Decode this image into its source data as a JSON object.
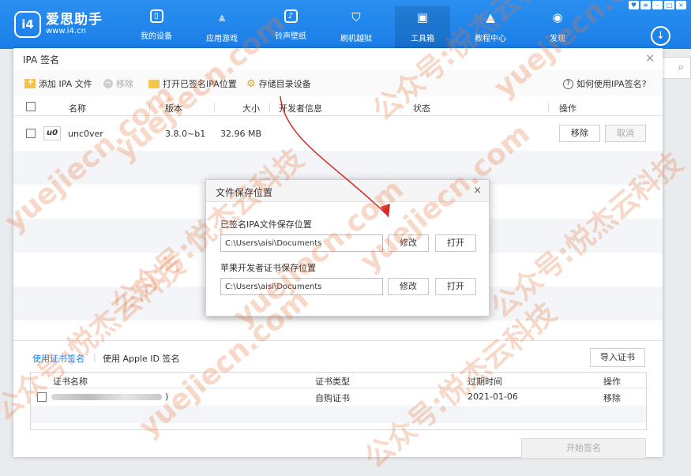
{
  "app": {
    "name": "爱思助手",
    "url": "www.i4.cn",
    "logo_mark": "i4"
  },
  "nav": [
    {
      "label": "我的设备",
      "icon": "device-icon"
    },
    {
      "label": "应用游戏",
      "icon": "apps-icon"
    },
    {
      "label": "铃声壁纸",
      "icon": "music-icon"
    },
    {
      "label": "刷机越狱",
      "icon": "flash-icon"
    },
    {
      "label": "工具箱",
      "icon": "toolbox-icon"
    },
    {
      "label": "教程中心",
      "icon": "graduation-cap-icon"
    },
    {
      "label": "发现",
      "icon": "compass-icon"
    }
  ],
  "dialog": {
    "title": "IPA 签名",
    "toolbar": {
      "add": "添加 IPA 文件",
      "remove": "移除",
      "open_signed": "打开已签名IPA位置",
      "storage": "存储目录设备",
      "help": "如何使用IPA签名?"
    },
    "table": {
      "headers": {
        "name": "名称",
        "version": "版本",
        "size": "大小",
        "developer": "开发者信息",
        "status": "状态",
        "actions": "操作"
      },
      "rows": [
        {
          "name": "unc0ver",
          "icon_text": "u0",
          "version": "3.8.0~b1",
          "size": "32.96 MB",
          "remove": "移除",
          "cancel": "取消"
        }
      ]
    },
    "cert": {
      "tab_cert": "使用证书签名",
      "tab_appleid": "使用 Apple ID 签名",
      "import": "导入证书",
      "headers": {
        "name": "证书名称",
        "type": "证书类型",
        "expires": "过期时间",
        "actions": "操作"
      },
      "rows": [
        {
          "name_tail": ")",
          "type": "自购证书",
          "expires": "2021-01-06",
          "action": "移除"
        }
      ]
    },
    "start_sign": "开始签名"
  },
  "modal": {
    "title": "文件保存位置",
    "signed_label": "已签名IPA文件保存位置",
    "signed_path": "C:\\Users\\aisi\\Documents",
    "cert_label": "苹果开发者证书保存位置",
    "cert_path": "C:\\Users\\aisi\\Documents",
    "modify": "修改",
    "open": "打开"
  },
  "colors": {
    "topbar": "#1a7ee8",
    "accent": "#1a7ee8",
    "arrow": "#d42a2a",
    "watermark": "#e6783c"
  },
  "watermarks": [
    "yuejiecn.com",
    "公众号:悦杰云科技"
  ]
}
